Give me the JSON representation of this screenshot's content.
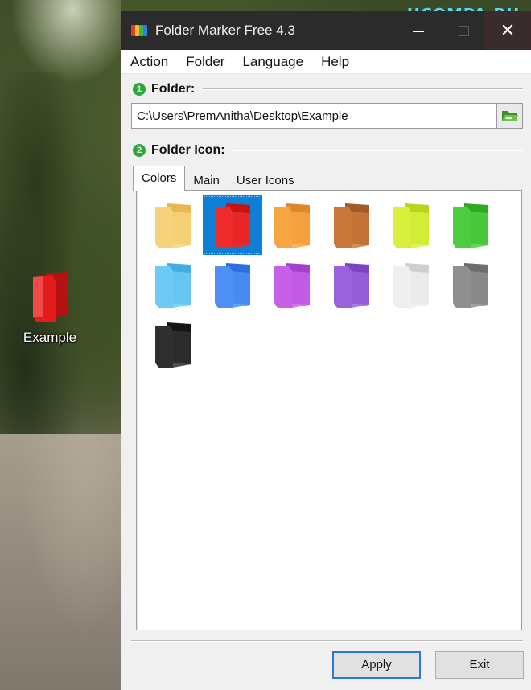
{
  "watermark": "UCOMPA.RU",
  "desktop": {
    "icon_label": "Example",
    "icon_color": "#e21c1c"
  },
  "window": {
    "title": "Folder Marker Free 4.3",
    "close_glyph": "✕"
  },
  "menu": [
    "Action",
    "Folder",
    "Language",
    "Help"
  ],
  "folder_section": {
    "step": "1",
    "label": "Folder:",
    "path": "C:\\Users\\PremAnitha\\Desktop\\Example",
    "browse_icon": "open-folder-icon"
  },
  "icon_section": {
    "step": "2",
    "label": "Folder Icon:"
  },
  "tabs": [
    {
      "label": "Colors",
      "active": true
    },
    {
      "label": "Main",
      "active": false
    },
    {
      "label": "User Icons",
      "active": false
    }
  ],
  "colors": [
    {
      "name": "yellow",
      "front": "#f6d27a",
      "back": "#e7b84f",
      "selected": false
    },
    {
      "name": "red",
      "front": "#ee2a2a",
      "back": "#c81313",
      "selected": true
    },
    {
      "name": "orange",
      "front": "#f7a443",
      "back": "#e2862a",
      "selected": false
    },
    {
      "name": "brown",
      "front": "#c9783a",
      "back": "#a25b24",
      "selected": false
    },
    {
      "name": "lime",
      "front": "#d8f03c",
      "back": "#b7d41f",
      "selected": false
    },
    {
      "name": "green",
      "front": "#4ccc3f",
      "back": "#2fa826",
      "selected": false
    },
    {
      "name": "light-blue",
      "front": "#6ccaf5",
      "back": "#41ade0",
      "selected": false
    },
    {
      "name": "blue",
      "front": "#4d8ff5",
      "back": "#2d6ee0",
      "selected": false
    },
    {
      "name": "magenta",
      "front": "#c660e8",
      "back": "#a63fce",
      "selected": false
    },
    {
      "name": "purple",
      "front": "#9a62dc",
      "back": "#7b43c2",
      "selected": false
    },
    {
      "name": "white",
      "front": "#efefef",
      "back": "#cfcfcf",
      "selected": false
    },
    {
      "name": "gray",
      "front": "#8f8f8f",
      "back": "#6e6e6e",
      "selected": false
    },
    {
      "name": "black",
      "front": "#2f2f2f",
      "back": "#141414",
      "selected": false
    }
  ],
  "buttons": {
    "apply": "Apply",
    "exit": "Exit"
  }
}
